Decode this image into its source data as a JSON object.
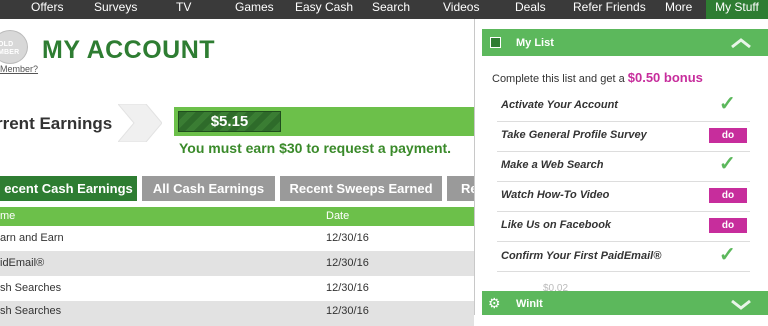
{
  "nav": {
    "items": [
      {
        "label": "Offers"
      },
      {
        "label": "Surveys"
      },
      {
        "label": "TV"
      },
      {
        "label": "Games"
      },
      {
        "label": "Easy Cash"
      },
      {
        "label": "Search"
      },
      {
        "label": "Videos"
      },
      {
        "label": "Deals"
      },
      {
        "label": "Refer Friends"
      },
      {
        "label": "More"
      },
      {
        "label": "My Stuff"
      }
    ]
  },
  "badge": {
    "text": "OLD\nMBER"
  },
  "member_link": "Member?",
  "page_title": "MY ACCOUNT",
  "earnings": {
    "label": "rrent Earnings",
    "amount": "$5.15",
    "note": "You must earn $30 to request a payment."
  },
  "tabs": [
    {
      "label": "ecent Cash Earnings",
      "active": true
    },
    {
      "label": "All Cash Earnings",
      "active": false
    },
    {
      "label": "Recent Sweeps Earned",
      "active": false
    },
    {
      "label": "Ref",
      "active": false
    }
  ],
  "table": {
    "headers": [
      "me",
      "Date"
    ],
    "rows": [
      {
        "name": "arn and Earn",
        "date": "12/30/16"
      },
      {
        "name": "idEmail®",
        "date": "12/30/16"
      },
      {
        "name": "sh Searches",
        "date": "12/30/16"
      },
      {
        "name": "sh Searches",
        "date": "12/30/16"
      }
    ]
  },
  "panel": {
    "title": "My List",
    "bonus_prefix": "Complete this list and get a",
    "bonus_amount": "$0.50 bonus",
    "tasks": [
      {
        "label": "Activate Your Account",
        "status": "done"
      },
      {
        "label": "Take General Profile Survey",
        "status": "do",
        "button": "do"
      },
      {
        "label": "Make a Web Search",
        "status": "done"
      },
      {
        "label": "Watch How-To Video",
        "status": "do",
        "button": "do"
      },
      {
        "label": "Like Us on Facebook",
        "status": "do",
        "button": "do"
      },
      {
        "label": "Confirm Your First PaidEmail®",
        "status": "done"
      }
    ],
    "faded_amount": "$0.02",
    "second_title": "WinIt"
  },
  "colors": {
    "nav_bg": "#3a3a3a",
    "brand_green": "#2e7d32",
    "light_green": "#6cc04a",
    "panel_green": "#5cb85c",
    "do_pink": "#c72d9c",
    "tab_gray": "#9a9a9a"
  },
  "icons": {
    "check": "checkmark-icon",
    "collapse": "chevron-up-icon",
    "expand": "chevron-down-icon",
    "gear": "gear-icon"
  }
}
